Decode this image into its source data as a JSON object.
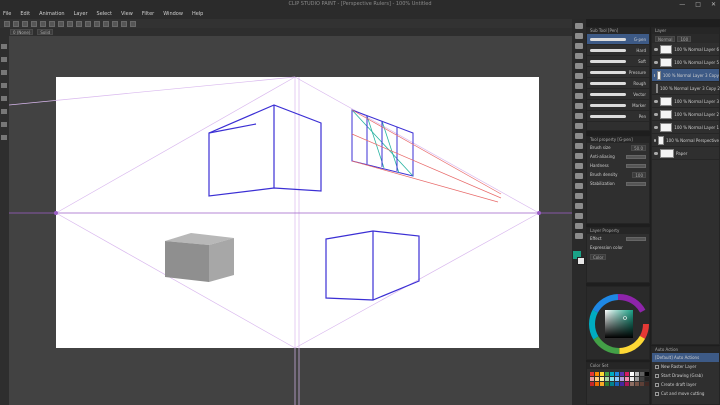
{
  "app": {
    "title": "CLIP STUDIO PAINT - [Perspective Rulers] - 100% Untitled",
    "window_buttons": [
      "—",
      "□",
      "✕"
    ]
  },
  "menu": [
    "File",
    "Edit",
    "Animation",
    "Layer",
    "Select",
    "View",
    "Filter",
    "Window",
    "Help"
  ],
  "tool_property_bar": {
    "field1": "0 (None)",
    "field2": "Solid"
  },
  "brush_panel": {
    "title": "Sub Tool [Pen]",
    "items": [
      {
        "label": "G-pen",
        "selected": true
      },
      {
        "label": "Hard"
      },
      {
        "label": "Soft"
      },
      {
        "label": "Pressure"
      },
      {
        "label": "Rough"
      },
      {
        "label": "Vector"
      },
      {
        "label": "Marker"
      },
      {
        "label": "Pen"
      },
      {
        "label": "Real G-pen"
      }
    ]
  },
  "subtool_property": {
    "title": "Tool property [G-pen]",
    "brush_size_label": "Brush size",
    "brush_size_value": "50.0",
    "antialias_label": "Anti-aliasing",
    "hardness_label": "Hardness",
    "density_label": "Brush density",
    "density_value": "100",
    "stabilization_label": "Stabilization"
  },
  "layer_property": {
    "title": "Layer Property",
    "effect_label": "Effect",
    "expression_label": "Expression color",
    "expression_value": "Color"
  },
  "color_panel": {
    "title": "Color Wheel",
    "main_color": "#1aa287",
    "sub_color": "#e8e8e8"
  },
  "swatch_panel": {
    "title": "Color Set",
    "colors": [
      "#e53935",
      "#fb8c00",
      "#fdd835",
      "#43a047",
      "#00acc1",
      "#1e88e5",
      "#5e35b1",
      "#d81b60",
      "#ffffff",
      "#bdbdbd",
      "#616161",
      "#000000",
      "#ef9a9a",
      "#ffcc80",
      "#fff59d",
      "#a5d6a7",
      "#80deea",
      "#90caf9",
      "#b39ddb",
      "#f48fb1",
      "#eeeeee",
      "#9e9e9e",
      "#424242",
      "#212121",
      "#c62828",
      "#ef6c00",
      "#f9a825",
      "#2e7d32",
      "#00838f",
      "#1565c0",
      "#4527a0",
      "#ad1457",
      "#8d6e63",
      "#795548",
      "#5d4037",
      "#3e2723"
    ]
  },
  "layer_panel": {
    "title": "Layer",
    "blend_mode": "Normal",
    "opacity": "100",
    "layers": [
      {
        "name": "100 % Normal Layer 6"
      },
      {
        "name": "100 % Normal Layer 5"
      },
      {
        "name": "100 % Normal Layer 3 Copy",
        "selected": true
      },
      {
        "name": "100 % Normal Layer 3 Copy 2"
      },
      {
        "name": "100 % Normal Layer 3"
      },
      {
        "name": "100 % Normal Layer 2"
      },
      {
        "name": "100 % Normal Layer 1"
      },
      {
        "name": "100 % Normal Perspective"
      },
      {
        "name": "Paper"
      }
    ]
  },
  "auto_action": {
    "title": "Auto Action",
    "set": "[Default] Auto Actions",
    "items": [
      "New Raster Layer",
      "Start Drawing (Grab)",
      "Create draft layer",
      "Cut and move cutting",
      "Create file selection"
    ]
  },
  "canvas_colors": {
    "paper": "#ffffff",
    "cube_stroke": "#3b2fd4",
    "guide": "#c79be3",
    "horizon": "#9c5fc7",
    "red_guide": "#e86a6a",
    "teal": "#27b3a1"
  }
}
